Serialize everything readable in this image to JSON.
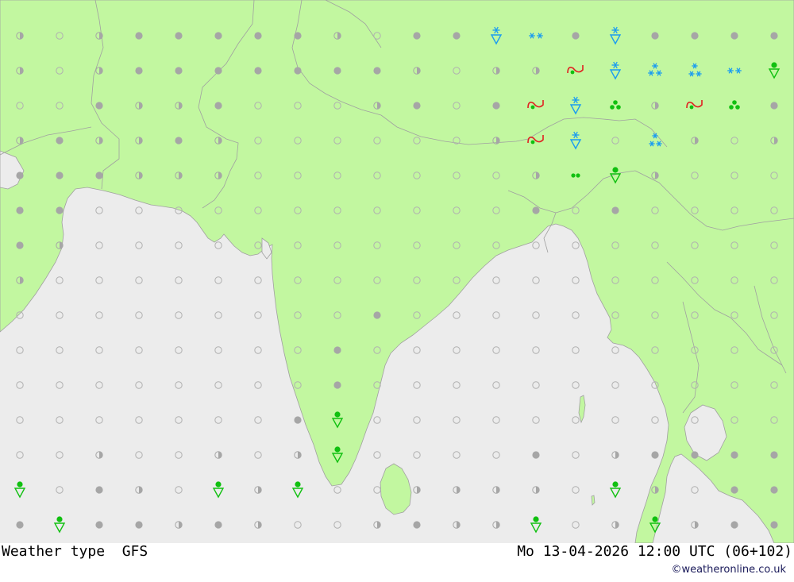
{
  "footer": {
    "title": "Weather type  GFS",
    "datetime": "Mo 13-04-2026 12:00 UTC (06+102)",
    "credit": "©weatheronline.co.uk"
  },
  "colors": {
    "land": "#c2f7a0",
    "sea": "#ececec",
    "border": "#a0a0a0",
    "dot_empty": "#b0b0b0",
    "dot_full": "#a6a6a6",
    "snow": "#1a9cf0",
    "rain": "#10c010",
    "thunder": "#e02020"
  },
  "grid": {
    "cols": 20,
    "rows": 15,
    "legend": "0=clear(open circle) 1=half-cloud 2=overcast(filled) R=rain shower S=snow shower SS=snow SN=heavy snow D=drizzle T=thunder TS=thunder+snow RS=rain+snow",
    "cells": [
      [
        "1",
        "0",
        "1",
        "2",
        "2",
        "2",
        "2",
        "2",
        "1",
        "0",
        "2",
        "2",
        "S",
        "SS",
        "2",
        "S",
        "2",
        "2",
        "2",
        "2"
      ],
      [
        "1",
        "0",
        "1",
        "2",
        "2",
        "2",
        "2",
        "2",
        "2",
        "2",
        "1",
        "0",
        "1",
        "1",
        "T",
        "S",
        "SN",
        "SB",
        "SS",
        "R"
      ],
      [
        "0",
        "0",
        "2",
        "1",
        "1",
        "2",
        "0",
        "0",
        "0",
        "1",
        "2",
        "0",
        "2",
        "T",
        "S",
        "RA",
        "1",
        "T",
        "RA",
        "2"
      ],
      [
        "1",
        "2",
        "1",
        "1",
        "2",
        "1",
        "0",
        "0",
        "0",
        "0",
        "0",
        "0",
        "1",
        "T",
        "S",
        "0",
        "SB",
        "1",
        "0",
        "1"
      ],
      [
        "2",
        "2",
        "2",
        "1",
        "1",
        "1",
        "0",
        "0",
        "0",
        "0",
        "0",
        "0",
        "0",
        "1",
        "D",
        "R",
        "1",
        "0",
        "0",
        "0"
      ],
      [
        "2",
        "2",
        "0",
        "0",
        "0",
        "0",
        "0",
        "0",
        "0",
        "0",
        "0",
        "0",
        "0",
        "2",
        "0",
        "2",
        "0",
        "0",
        "0",
        "0"
      ],
      [
        "2",
        "1",
        "0",
        "0",
        "0",
        "0",
        "0",
        "0",
        "0",
        "0",
        "0",
        "0",
        "0",
        "0",
        "0",
        "0",
        "0",
        "0",
        "0",
        "0"
      ],
      [
        "1",
        "0",
        "0",
        "0",
        "0",
        "0",
        "0",
        "0",
        "0",
        "0",
        "0",
        "0",
        "0",
        "0",
        "0",
        "0",
        "0",
        "0",
        "0",
        "0"
      ],
      [
        "0",
        "0",
        "0",
        "0",
        "0",
        "0",
        "0",
        "0",
        "0",
        "2",
        "0",
        "0",
        "0",
        "0",
        "0",
        "0",
        "0",
        "0",
        "0",
        "0"
      ],
      [
        "0",
        "0",
        "0",
        "0",
        "0",
        "0",
        "0",
        "0",
        "2",
        "0",
        "0",
        "0",
        "0",
        "0",
        "0",
        "0",
        "0",
        "0",
        "0",
        "0"
      ],
      [
        "0",
        "0",
        "0",
        "0",
        "0",
        "0",
        "0",
        "0",
        "2",
        "0",
        "0",
        "0",
        "0",
        "0",
        "0",
        "0",
        "0",
        "0",
        "0",
        "0"
      ],
      [
        "0",
        "0",
        "0",
        "0",
        "0",
        "0",
        "0",
        "2",
        "R",
        "0",
        "0",
        "0",
        "0",
        "0",
        "0",
        "0",
        "0",
        "0",
        "0",
        "0"
      ],
      [
        "0",
        "0",
        "1",
        "0",
        "0",
        "1",
        "0",
        "1",
        "R",
        "0",
        "0",
        "0",
        "0",
        "2",
        "0",
        "1",
        "2",
        "2",
        "2",
        "2"
      ],
      [
        "R",
        "0",
        "2",
        "1",
        "0",
        "R",
        "1",
        "R",
        "0",
        "0",
        "1",
        "1",
        "1",
        "1",
        "0",
        "R",
        "1",
        "0",
        "2",
        "2"
      ],
      [
        "2",
        "R",
        "2",
        "2",
        "1",
        "2",
        "1",
        "0",
        "0",
        "1",
        "2",
        "1",
        "1",
        "R",
        "0",
        "1",
        "R",
        "1",
        "2",
        "2"
      ]
    ]
  }
}
